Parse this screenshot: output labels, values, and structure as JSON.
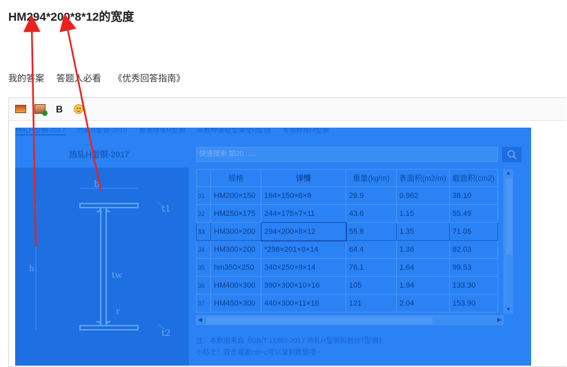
{
  "question": {
    "title": "HM294*200*8*12的宽度"
  },
  "answer_bar": {
    "my_answer": "我的答案",
    "must_read": "答题人必看",
    "guide": "《优秀回答指南》"
  },
  "toolbar": {
    "bold_label": "B"
  },
  "screenshot": {
    "tabs": [
      "热轧H型钢-2017",
      "热轧H型钢-2010",
      "普通焊接H型钢",
      "高频焊接轻型薄壁H型钢",
      "专用焊接H型钢"
    ],
    "left_title": "热轧H型钢-2017",
    "search_placeholder": "快速搜索 如20......",
    "diagram_labels": {
      "b": "b",
      "t1": "t1",
      "tw": "tw",
      "t2": "t2",
      "h": "h",
      "r": "r"
    },
    "table": {
      "headers": [
        "",
        "规格",
        "详情",
        "重量(kg/m)",
        "表面积(m2/m)",
        "截面积(cm2)"
      ],
      "rows": [
        [
          "31",
          "HM200×150",
          "194×150×6×9",
          "29.9",
          "0.962",
          "38.10"
        ],
        [
          "32",
          "HM250×175",
          "244×175×7×11",
          "43.6",
          "1.15",
          "55.49"
        ],
        [
          "33",
          "HM300×200",
          "294×200×8×12",
          "55.8",
          "1.35",
          "71.05"
        ],
        [
          "34",
          "HM300×200",
          "*298×201×9×14",
          "64.4",
          "1.36",
          "82.03"
        ],
        [
          "35",
          "hm350×250",
          "340×250×9×14",
          "78.1",
          "1.64",
          "99.53"
        ],
        [
          "36",
          "HM400×300",
          "390×300×10×16",
          "105",
          "1.94",
          "133.30"
        ],
        [
          "37",
          "HM450×300",
          "440×300×11×18",
          "121",
          "2.04",
          "153.90"
        ]
      ]
    },
    "note1": "注：本数据来自《GB/T 11263-2017 热轧H型钢和剖分T型钢》",
    "note2": "小贴士：双击或者ctrl+c可以复制数据哦~"
  },
  "colors": {
    "overlay": "#2a82f5",
    "arrow": "#e8231e"
  }
}
